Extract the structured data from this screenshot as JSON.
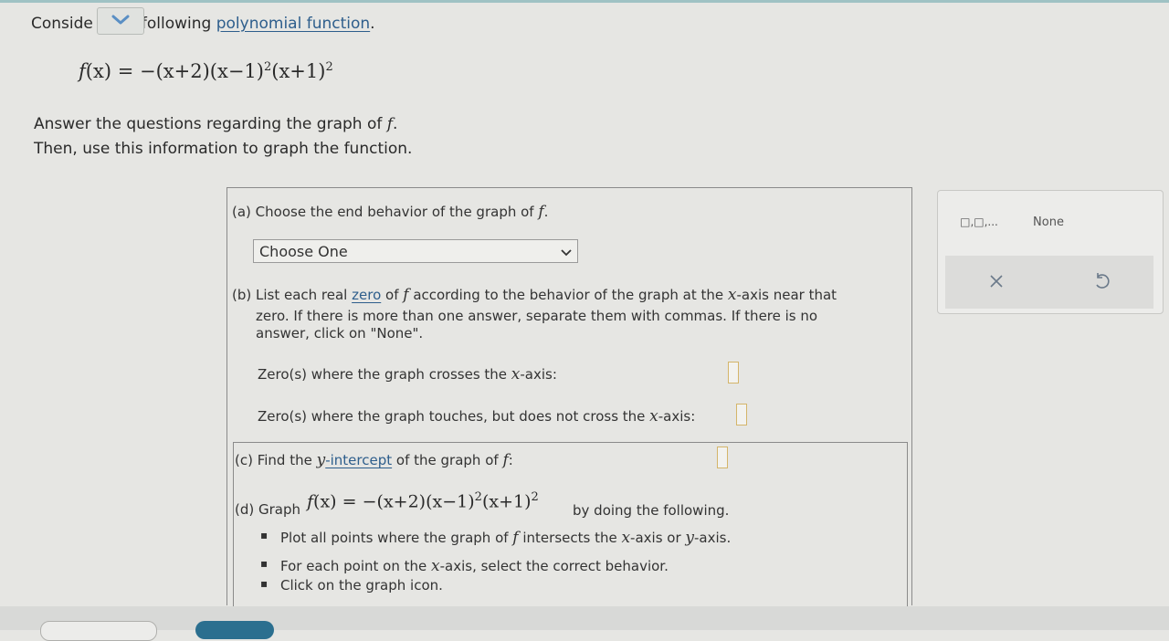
{
  "header": {
    "intro_prefix": "Conside",
    "intro_suffix": "following",
    "intro_link": "polynomial function",
    "intro_period": "."
  },
  "formula_parts": {
    "f": "f",
    "x": "x",
    "paren_x": "(x)",
    "eq": "=",
    "neg": "−",
    "t1": "(x+2)",
    "t2": "(x−1)",
    "t3": "(x+1)",
    "exp": "2"
  },
  "description": {
    "line1_prefix": "Answer the questions regarding the graph of ",
    "line1_var": "f",
    "line1_suffix": ".",
    "line2": "Then, use this information to graph the function."
  },
  "part_a": {
    "label": "(a) Choose the end behavior of the graph of ",
    "var": "f",
    "period": ".",
    "dropdown_value": "Choose One"
  },
  "part_b": {
    "label": "(b) List each real ",
    "zero_link": "zero",
    "of": " of ",
    "var": "f",
    "label_rest": " according to the behavior of the graph at the ",
    "xaxis_x": "x",
    "xaxis_rest": "-axis near that",
    "line2": "zero. If there is more than one answer, separate them with commas. If there is no",
    "line3": "answer, click on \"None\".",
    "crosses_label": "Zero(s) where the graph crosses the ",
    "crosses_x": "x",
    "crosses_rest": "-axis:",
    "touches_label": "Zero(s) where the graph touches, but does not cross the ",
    "touches_x": "x",
    "touches_rest": "-axis:"
  },
  "part_c": {
    "label": "(c) Find the ",
    "y": "y",
    "link": "-intercept",
    "rest": " of the graph of ",
    "var": "f",
    "colon": ":"
  },
  "part_d": {
    "label": "(d) Graph ",
    "suffix": " by doing the following.",
    "bullet1_prefix": "Plot all points where the graph of ",
    "bullet1_var": "f",
    "bullet1_mid": " intersects the ",
    "bullet1_x": "x",
    "bullet1_mid2": "-axis or ",
    "bullet1_y": "y",
    "bullet1_rest": "-axis.",
    "bullet2_prefix": "For each point on the ",
    "bullet2_x": "x",
    "bullet2_rest": "-axis, select the correct behavior.",
    "bullet3": "Click on the graph icon."
  },
  "tools": {
    "multi_label": "□,□,...",
    "none_label": "None",
    "clear_icon": "close-icon",
    "undo_icon": "undo-icon"
  },
  "colors": {
    "link": "#2e5e8c",
    "accent": "#5a8fc4",
    "answer_box_border": "#d4b56a"
  }
}
